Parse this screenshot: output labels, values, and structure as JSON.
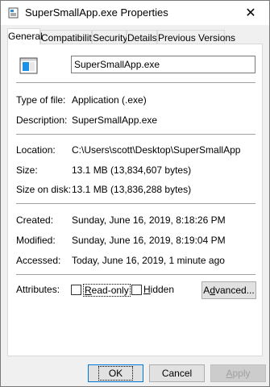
{
  "window": {
    "title": "SuperSmallApp.exe Properties",
    "close_glyph": "✕"
  },
  "tabs": [
    {
      "label": "General",
      "active": true
    },
    {
      "label": "Compatibility",
      "active": false
    },
    {
      "label": "Security",
      "active": false
    },
    {
      "label": "Details",
      "active": false
    },
    {
      "label": "Previous Versions",
      "active": false
    }
  ],
  "general": {
    "file_name": "SuperSmallApp.exe",
    "rows": {
      "type_label": "Type of file:",
      "type_value": "Application (.exe)",
      "description_label": "Description:",
      "description_value": "SuperSmallApp.exe",
      "location_label": "Location:",
      "location_value": "C:\\Users\\scott\\Desktop\\SuperSmallApp",
      "size_label": "Size:",
      "size_value": "13.1 MB (13,834,607 bytes)",
      "size_on_disk_label": "Size on disk:",
      "size_on_disk_value": "13.1 MB (13,836,288 bytes)",
      "created_label": "Created:",
      "created_value": "Sunday, June 16, 2019, 8:18:26 PM",
      "modified_label": "Modified:",
      "modified_value": "Sunday, June 16, 2019, 8:19:04 PM",
      "accessed_label": "Accessed:",
      "accessed_value": "Today, June 16, 2019, 1 minute ago"
    },
    "attributes": {
      "label": "Attributes:",
      "readonly_label_mnemonic": "R",
      "readonly_label_rest": "ead-only",
      "readonly_checked": false,
      "hidden_label_mnemonic": "H",
      "hidden_label_rest": "idden",
      "hidden_checked": false,
      "advanced_label_start": "A",
      "advanced_label_mnemonic": "d",
      "advanced_label_rest": "vanced..."
    }
  },
  "buttons": {
    "ok": "OK",
    "cancel": "Cancel",
    "apply_mnemonic": "A",
    "apply_rest": "pply"
  },
  "colors": {
    "accent": "#0078d7",
    "icon_blue": "#1e90e6"
  }
}
